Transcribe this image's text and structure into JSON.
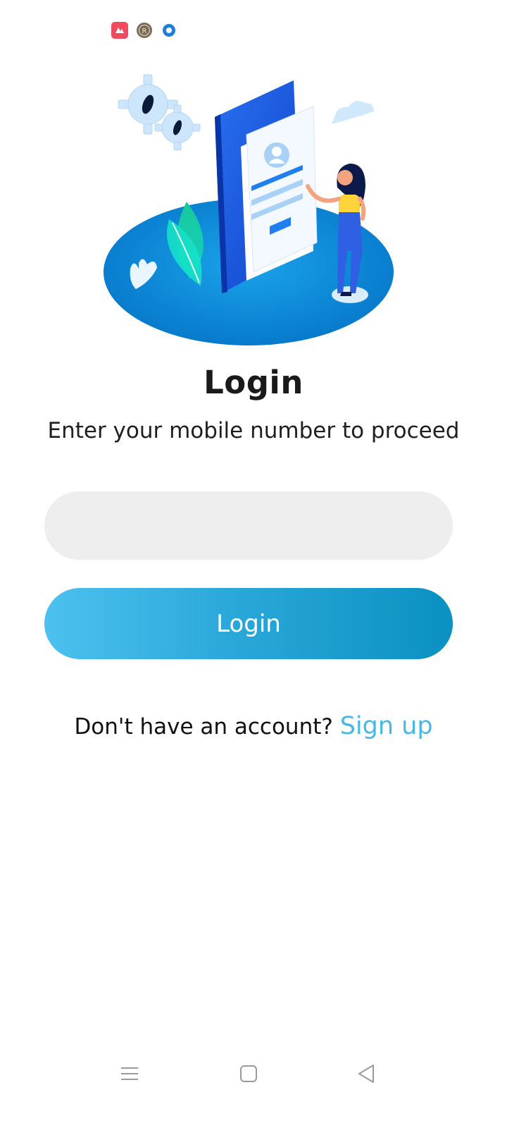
{
  "status_bar": {
    "icons": [
      "app-notification-icon",
      "registered-icon",
      "circle-dot-icon"
    ]
  },
  "illustration": {
    "icon": "login-illustration"
  },
  "login_screen": {
    "title": "Login",
    "subtitle": "Enter your mobile number to proceed",
    "phone_input": {
      "value": "",
      "placeholder": ""
    },
    "login_button_label": "Login",
    "signup_prompt": "Don't have an account?",
    "signup_link_label": "Sign up"
  },
  "colors": {
    "accent": "#4ab8e6",
    "button_start": "#4cc1ef",
    "button_end": "#0a91c1",
    "input_bg": "#eeeeee"
  },
  "nav_bar": {
    "buttons": [
      "menu-icon",
      "home-icon",
      "back-icon"
    ]
  }
}
